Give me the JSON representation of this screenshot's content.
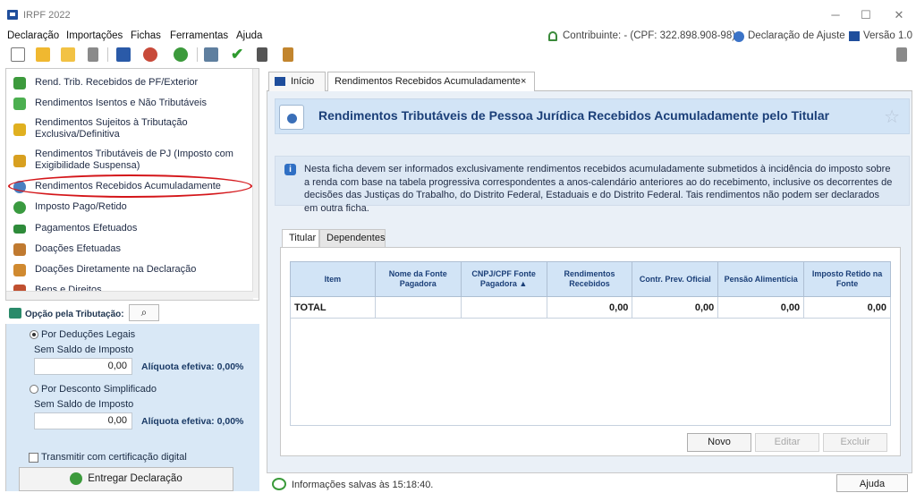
{
  "window": {
    "title": "IRPF 2022",
    "minimize": "─",
    "maximize": "☐",
    "close": "✕"
  },
  "menu": [
    "Declaração",
    "Importações",
    "Fichas",
    "Ferramentas",
    "Ajuda"
  ],
  "status": {
    "contribuinte": "Contribuinte:  - (CPF: 322.898.908-98)",
    "declaracao": "Declaração de Ajuste",
    "versao": "Versão 1.0"
  },
  "toolbar_icons": [
    "new-file-icon",
    "open-folder-icon",
    "folder-icon",
    "trash-icon",
    "receita-icon",
    "refresh-icon",
    "globe-icon",
    "print-icon",
    "check-icon",
    "calculator-icon",
    "book-icon"
  ],
  "nav": {
    "items": [
      {
        "label": "Rend. Trib. Recebidos de PF/Exterior",
        "icon": "leaf-icon",
        "color": "#3c9a3c"
      },
      {
        "label": "Rendimentos Isentos e Não Tributáveis",
        "icon": "check-leaf-icon",
        "color": "#4caf50"
      },
      {
        "label": "Rendimentos Sujeitos à Tributação",
        "label2": "Exclusiva/Definitiva",
        "icon": "warning-icon",
        "color": "#e0b020"
      },
      {
        "label": "Rendimentos Tributáveis de PJ (Imposto com",
        "label2": "Exigibilidade Suspensa)",
        "icon": "scale-icon",
        "color": "#d8a020"
      },
      {
        "label": "Rendimentos Recebidos Acumuladamente",
        "icon": "accumulated-icon",
        "color": "#4a7fc0"
      },
      {
        "label": "Imposto Pago/Retido",
        "icon": "coin-icon",
        "color": "#3a9a40"
      },
      {
        "label": "Pagamentos Efetuados",
        "icon": "card-icon",
        "color": "#2e8b3a"
      },
      {
        "label": "Doações Efetuadas",
        "icon": "gift-icon",
        "color": "#c07a30"
      },
      {
        "label": "Doações Diretamente na Declaração",
        "icon": "hand-gift-icon",
        "color": "#d08a30"
      },
      {
        "label": "Bens e Direitos",
        "icon": "house-icon",
        "color": "#c05030"
      }
    ]
  },
  "options": {
    "title": "Opção pela Tributação:",
    "deducoes_label": "Por Deduções Legais",
    "deducoes_sub": "Sem Saldo de Imposto",
    "deducoes_value": "0,00",
    "deducoes_aliquota": "Alíquota efetiva: 0,00%",
    "simplificado_label": "Por Desconto Simplificado",
    "simplificado_sub": "Sem Saldo de Imposto",
    "simplificado_value": "0,00",
    "simplificado_aliquota": "Alíquota efetiva: 0,00%",
    "transmitir_label": "Transmitir com certificação digital",
    "entregar_label": "Entregar Declaração"
  },
  "tabs": {
    "inicio": "Início",
    "active": "Rendimentos Recebidos Acumuladamente",
    "close": "×"
  },
  "page": {
    "title": "Rendimentos Tributáveis de Pessoa Jurídica Recebidos Acumuladamente pelo Titular",
    "info": "Nesta ficha devem ser informados exclusivamente rendimentos recebidos acumuladamente submetidos à incidência do imposto sobre a renda com base na tabela progressiva correspondentes a anos-calendário anteriores ao do recebimento, inclusive os decorrentes de decisões das Justiças do Trabalho, do Distrito Federal, Estaduais e do Distrito Federal. Tais rendimentos não podem ser declarados em outra ficha.",
    "inner_tabs": [
      "Titular",
      "Dependentes"
    ],
    "columns": [
      "Item",
      "Nome da Fonte Pagadora",
      "CNPJ/CPF Fonte Pagadora",
      "Rendimentos Recebidos",
      "Contr. Prev. Oficial",
      "Pensão Alimentícia",
      "Imposto Retido na Fonte"
    ],
    "sort_indicator": "▲",
    "total_row": [
      "TOTAL",
      "",
      "",
      "0,00",
      "0,00",
      "0,00",
      "0,00"
    ],
    "buttons": {
      "novo": "Novo",
      "editar": "Editar",
      "excluir": "Excluir"
    }
  },
  "statusbar": {
    "saved": "Informações salvas às 15:18:40.",
    "help": "Ajuda"
  }
}
